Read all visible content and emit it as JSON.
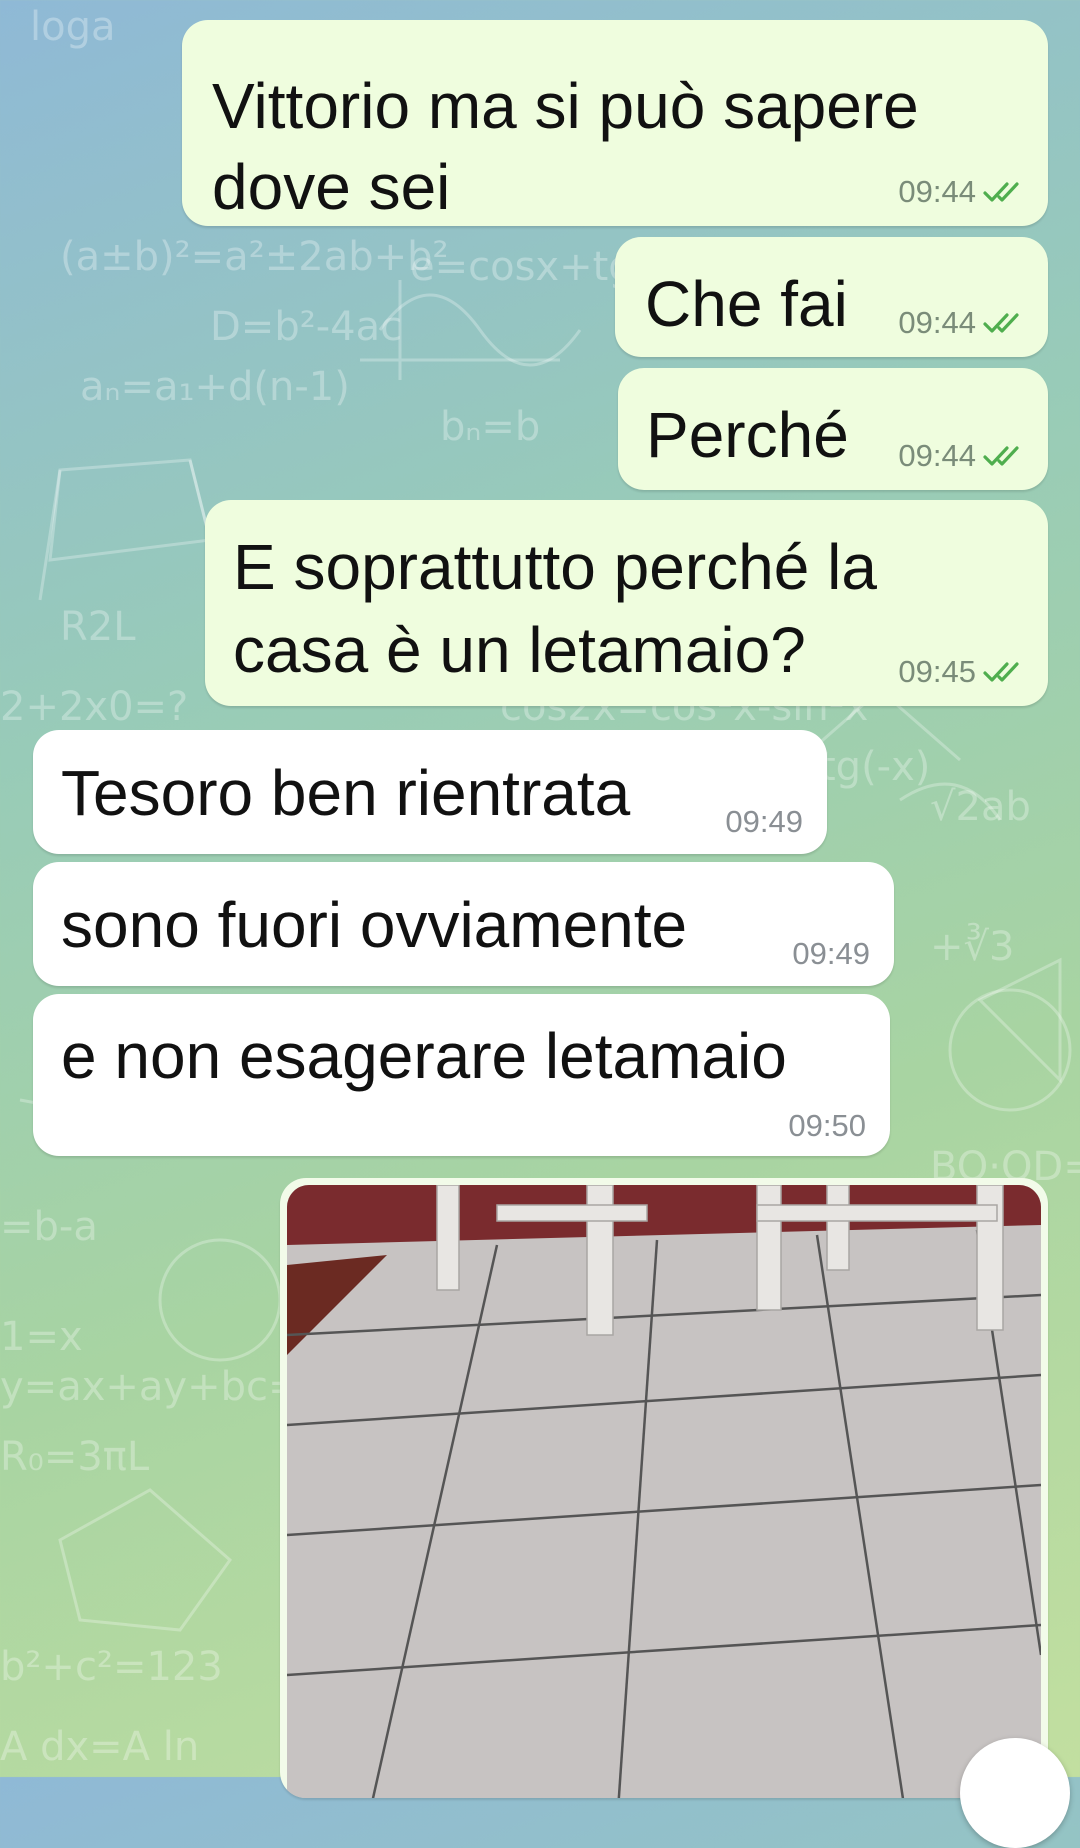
{
  "chat": {
    "messages": [
      {
        "direction": "outgoing",
        "text_lines": [
          "Vittorio ma si può sapere",
          "dove sei"
        ],
        "time": "09:44",
        "status": "read"
      },
      {
        "direction": "outgoing",
        "text_lines": [
          "Che fai"
        ],
        "time": "09:44",
        "status": "read"
      },
      {
        "direction": "outgoing",
        "text_lines": [
          "Perché"
        ],
        "time": "09:44",
        "status": "read"
      },
      {
        "direction": "outgoing",
        "text_lines": [
          "E soprattutto perché la",
          "casa è un letamaio?"
        ],
        "time": "09:45",
        "status": "read"
      },
      {
        "direction": "incoming",
        "text_lines": [
          "Tesoro ben rientrata"
        ],
        "time": "09:49"
      },
      {
        "direction": "incoming",
        "text_lines": [
          "sono fuori ovviamente"
        ],
        "time": "09:49"
      },
      {
        "direction": "incoming",
        "text_lines": [
          "e non esagerare letamaio"
        ],
        "time": "09:50"
      },
      {
        "direction": "outgoing",
        "type": "photo",
        "content": "tiled floor with white chair legs"
      }
    ]
  },
  "icons": {
    "read_receipt": "double-check-icon",
    "scroll_button": "scroll-down-icon"
  },
  "colors": {
    "outgoing_bubble": "#effdde",
    "incoming_bubble": "#ffffff",
    "read_check": "#4fae4e",
    "outgoing_time": "#7a8c79",
    "incoming_time": "#8a8f94"
  }
}
